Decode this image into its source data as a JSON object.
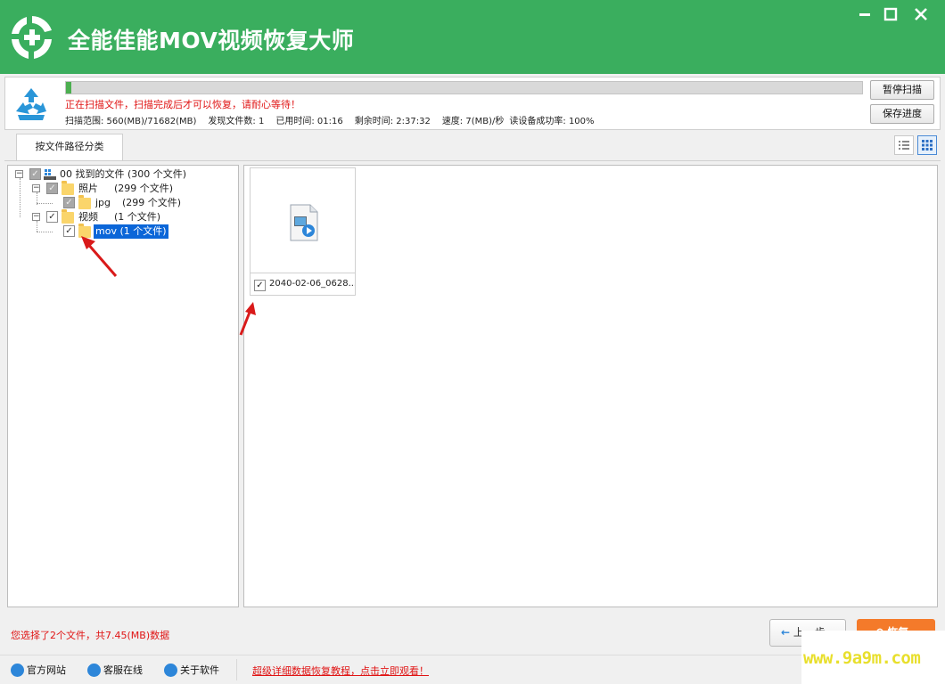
{
  "app": {
    "title": "全能佳能MOV视频恢复大师",
    "window_controls": [
      "minimize",
      "maximize",
      "close"
    ]
  },
  "scan": {
    "progress_fraction": 0.007,
    "warning": "正在扫描文件，扫描完成后才可以恢复，请耐心等待！",
    "stats": {
      "range": "扫描范围: 560(MB)/71682(MB)",
      "found": "发现文件数: 1",
      "elapsed": "已用时间: 01:16",
      "remaining": "剩余时间: 2:37:32",
      "speed": "速度: 7(MB)/秒",
      "read_rate": "读设备成功率: 100%"
    },
    "pause_button": "暂停扫描",
    "save_button": "保存进度"
  },
  "tabs": {
    "active_label": "按文件路径分类",
    "view_modes": [
      "list-view-icon",
      "grid-view-icon"
    ]
  },
  "tree": {
    "root": {
      "label": "00 找到的文件 (300 个文件)",
      "checked": "partial"
    },
    "photos": {
      "label": "照片",
      "count": "(299 个文件)",
      "checked": "partial"
    },
    "jpg": {
      "label": "jpg",
      "count": "(299 个文件)",
      "checked": "partial"
    },
    "video": {
      "label": "视频",
      "count": "(1 个文件)",
      "checked": true
    },
    "mov": {
      "label": "mov    (1 个文件)",
      "checked": true,
      "selected": true
    }
  },
  "files": [
    {
      "name": "2040-02-06_0628...",
      "checked": true,
      "icon": "video-file-icon"
    }
  ],
  "status": {
    "selection_info": "您选择了2个文件，共7.45(MB)数据",
    "back_button": "上一步",
    "recover_button": "恢复"
  },
  "footer": {
    "website": "官方网站",
    "service": "客服在线",
    "about": "关于软件",
    "tutorial": "超级详细数据恢复教程，点击立即观看！"
  },
  "watermark": "www.9a9m.com",
  "colors": {
    "title_bar": "#3aae5e",
    "warning_text": "#e01414",
    "selection": "#0b66d8",
    "recover_button": "#f47a2a",
    "watermark": "#e8df2c"
  }
}
